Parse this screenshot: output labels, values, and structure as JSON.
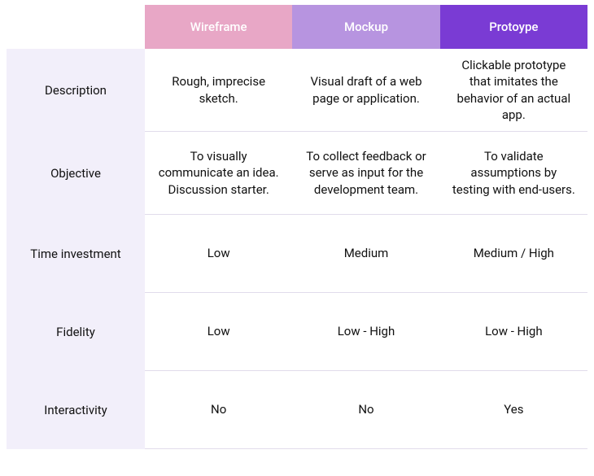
{
  "chart_data": {
    "type": "table",
    "columns": [
      "Wireframe",
      "Mockup",
      "Protoype"
    ],
    "rows": [
      "Description",
      "Objective",
      "Time investment",
      "Fidelity",
      "Interactivity"
    ],
    "cells": {
      "Description": [
        "Rough, imprecise sketch.",
        "Visual draft of a web page or application.",
        "Clickable prototype that imitates the behavior of an actual app."
      ],
      "Objective": [
        "To visually communicate an idea. Discussion starter.",
        "To collect feedback or serve as input for the development team.",
        "To validate assumptions by testing with end-users."
      ],
      "Time investment": [
        "Low",
        "Medium",
        "Medium / High"
      ],
      "Fidelity": [
        "Low",
        "Low - High",
        "Low - High"
      ],
      "Interactivity": [
        "No",
        "No",
        "Yes"
      ]
    },
    "header_colors": {
      "Wireframe": "#E8A7C6",
      "Mockup": "#B794E0",
      "Protoype": "#7A3BD4"
    }
  }
}
